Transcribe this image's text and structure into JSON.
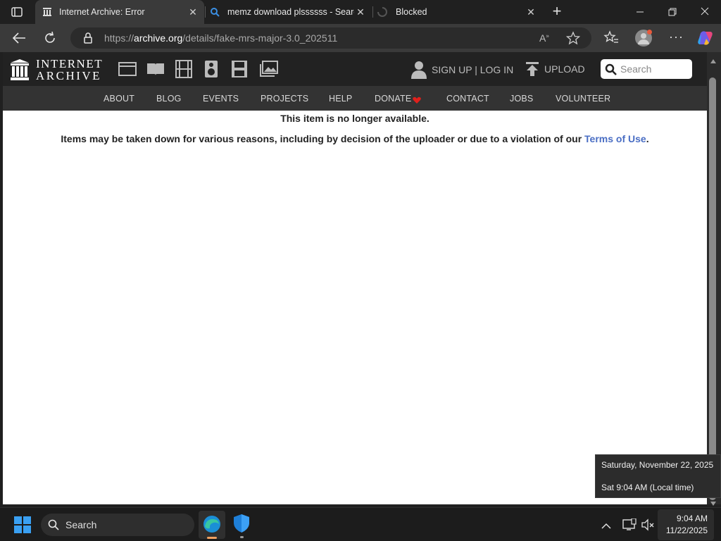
{
  "browser": {
    "tabs": [
      {
        "title": "Internet Archive: Error",
        "active": true
      },
      {
        "title": "memz download plssssss - Search",
        "active": false
      },
      {
        "title": "Blocked",
        "active": false
      }
    ],
    "url": {
      "prefix": "https://",
      "domain": "archive.org",
      "path": "/details/fake-mrs-major-3.0_202511"
    }
  },
  "site": {
    "logo_line1": "INTERNET",
    "logo_line2": "ARCHIVE",
    "signup_label": "SIGN UP | LOG IN",
    "upload_label": "UPLOAD",
    "search_placeholder": "Search",
    "menu": [
      "ABOUT",
      "BLOG",
      "EVENTS",
      "PROJECTS",
      "HELP",
      "DONATE",
      "CONTACT",
      "JOBS",
      "VOLUNTEER"
    ]
  },
  "content": {
    "heading": "This item is no longer available.",
    "body": "Items may be taken down for various reasons, including by decision of the uploader or due to a violation of our ",
    "link": "Terms of Use",
    "period": "."
  },
  "tooltip": {
    "date_long": "Saturday, November 22, 2025",
    "time_local": "Sat 9:04 AM (Local time)"
  },
  "taskbar": {
    "search_label": "Search",
    "clock_time": "9:04 AM",
    "clock_date": "11/22/2025"
  },
  "colors": {
    "link": "#4a6ec4",
    "donate_heart": "#e0201c",
    "ia_header": "#222222"
  }
}
